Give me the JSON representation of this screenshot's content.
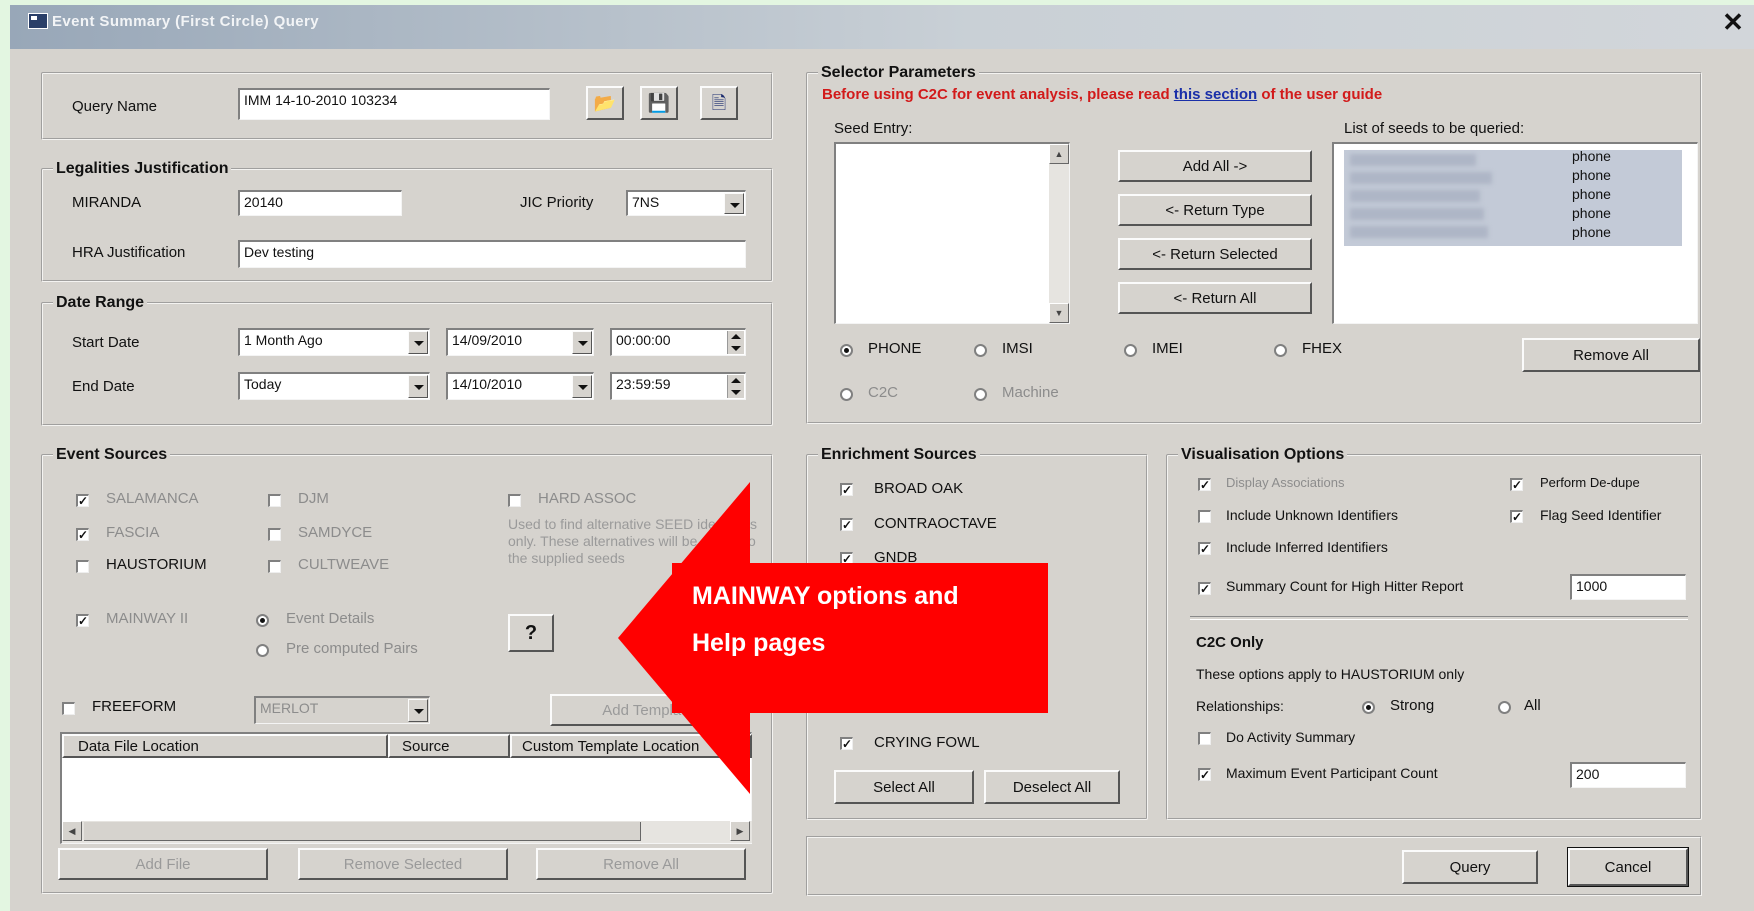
{
  "window": {
    "title": "Event Summary (First Circle) Query",
    "close_label": "✕"
  },
  "query": {
    "label": "Query Name",
    "value": "IMM 14-10-2010 103234"
  },
  "toolbar": {
    "open_icon": "folder-open-icon",
    "save_icon": "floppy-disk-icon",
    "new_icon": "new-document-icon"
  },
  "legalities": {
    "title": "Legalities Justification",
    "miranda_label": "MIRANDA",
    "miranda_value": "20140",
    "jic_label": "JIC Priority",
    "jic_value": "7NS",
    "hra_label": "HRA Justification",
    "hra_value": "Dev testing"
  },
  "date_range": {
    "title": "Date Range",
    "start_label": "Start Date",
    "start_preset": "1 Month Ago",
    "start_date": "14/09/2010",
    "start_time": "00:00:00",
    "end_label": "End Date",
    "end_preset": "Today",
    "end_date": "14/10/2010",
    "end_time": "23:59:59"
  },
  "event_sources": {
    "title": "Event Sources",
    "salamanca": "SALAMANCA",
    "djm": "DJM",
    "hard_assoc": "HARD ASSOC",
    "fascia": "FASCIA",
    "samdyce": "SAMDYCE",
    "haustorium": "HAUSTORIUM",
    "cultweave": "CULTWEAVE",
    "hint": "Used to find alternative SEED identifiers only. These alternatives will be added to the supplied seeds",
    "mainway": "MAINWAY II",
    "event_details": "Event Details",
    "precomputed": "Pre computed Pairs",
    "help": "?",
    "freeform": "FREEFORM",
    "freeform_value": "MERLOT",
    "add_template": "Add Template",
    "col_location": "Data File Location",
    "col_source": "Source",
    "col_template": "Custom Template Location",
    "add_file": "Add File",
    "remove_selected": "Remove Selected",
    "remove_all": "Remove All"
  },
  "selector": {
    "title": "Selector Parameters",
    "warning_before": "Before using C2C for event analysis, please read ",
    "warning_link": "this section",
    "warning_after": " of the user guide",
    "seed_entry_label": "Seed Entry:",
    "list_label": "List of seeds to be queried:",
    "seed_types": [
      "phone",
      "phone",
      "phone",
      "phone",
      "phone"
    ],
    "add_all": "Add All ->",
    "return_type": "<- Return Type",
    "return_selected": "<- Return Selected",
    "return_all": "<- Return All",
    "remove_all": "Remove All",
    "phone": "PHONE",
    "imsi": "IMSI",
    "imei": "IMEI",
    "fhex": "FHEX",
    "c2c": "C2C",
    "machine": "Machine"
  },
  "enrichment": {
    "title": "Enrichment Sources",
    "items": [
      "BROAD OAK",
      "CONTRAOCTAVE",
      "GNDB",
      "CRYING FOWL"
    ],
    "select_all": "Select All",
    "deselect_all": "Deselect All"
  },
  "visualisation": {
    "title": "Visualisation Options",
    "display_assoc": "Display Associations",
    "perform_dedupe": "Perform De-dupe",
    "include_unknown": "Include Unknown Identifiers",
    "flag_seed": "Flag Seed Identifier",
    "include_inferred": "Include Inferred Identifiers",
    "summary_count": "Summary Count for High Hitter Report",
    "summary_value": "1000",
    "c2c_title": "C2C Only",
    "c2c_note": "These options apply to HAUSTORIUM only",
    "relationships": "Relationships:",
    "strong": "Strong",
    "all": "All",
    "do_activity": "Do Activity Summary",
    "max_event": "Maximum Event Participant Count",
    "max_value": "200"
  },
  "actions": {
    "query": "Query",
    "cancel": "Cancel"
  },
  "callout": {
    "line1": "MAINWAY options and",
    "line2": "Help pages"
  }
}
